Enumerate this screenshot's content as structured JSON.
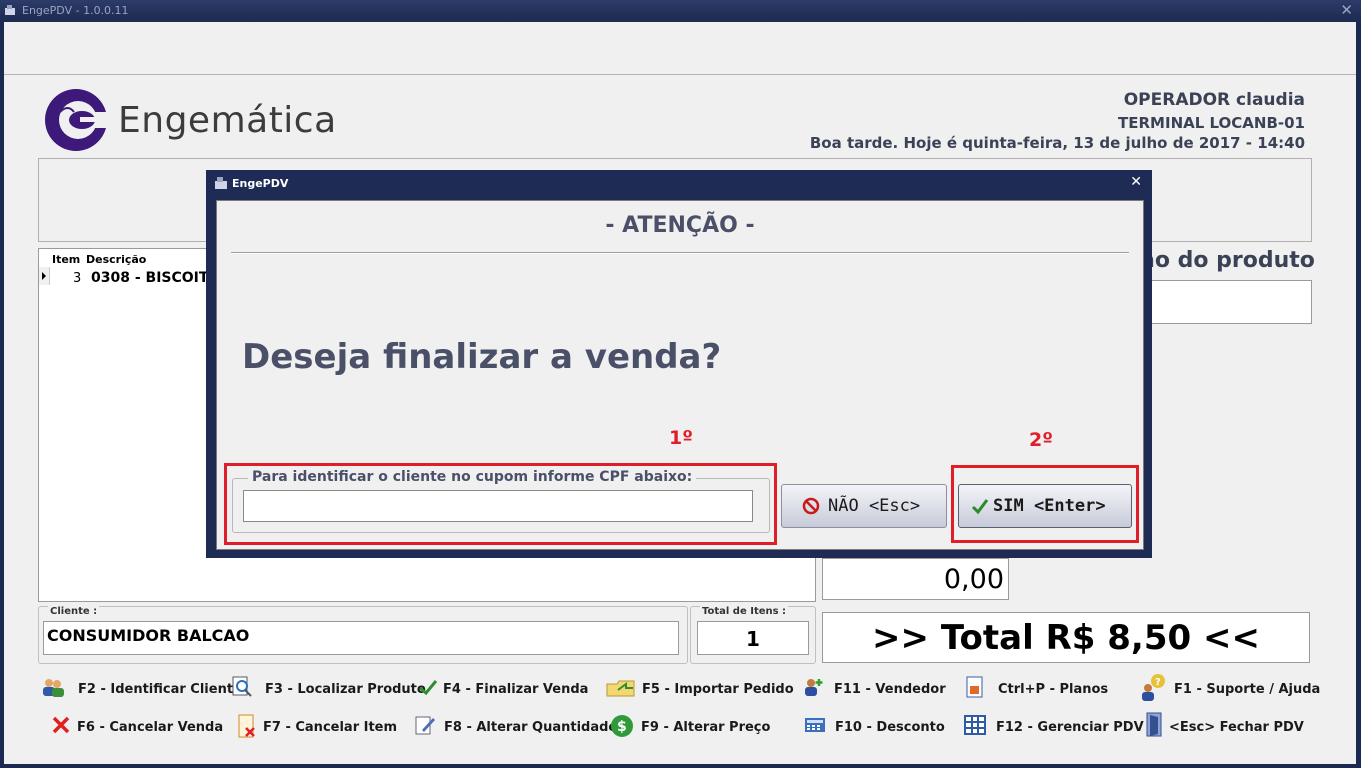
{
  "window": {
    "title": "EngePDV - 1.0.0.11",
    "close_glyph": "✕"
  },
  "logo": {
    "text": "Engemática",
    "icon": "engematica-logo"
  },
  "operator": {
    "line1": "OPERADOR claudia",
    "line2": "TERMINAL LOCANB-01",
    "line3": "Boa tarde. Hoje é quinta-feira, 13 de julho de 2017 - 14:40"
  },
  "grid": {
    "headers": [
      "Item",
      "Descrição"
    ],
    "rows": [
      {
        "item": "3",
        "descricao": "0308 - BISCOIT"
      }
    ]
  },
  "product_label": "ão do produto",
  "subtotal_value": "0,00",
  "client": {
    "label": "Cliente :",
    "value": "CONSUMIDOR BALCAO"
  },
  "total_items": {
    "label": "Total de Itens :",
    "value": "1"
  },
  "total": "&gt;&gt; Total R$ 8,50 &lt;&lt;",
  "total_text": ">> Total R$ 8,50 <<",
  "shortcuts_row1": [
    {
      "label": "F2 - Identificar Cliente",
      "icon": "users-icon"
    },
    {
      "label": "F3 - Localizar Produto",
      "icon": "search-doc-icon"
    },
    {
      "label": "F4 - Finalizar Venda",
      "icon": "check-icon"
    },
    {
      "label": "F5 - Importar Pedido",
      "icon": "folder-import-icon"
    },
    {
      "label": "F11 - Vendedor",
      "icon": "add-user-icon"
    },
    {
      "label": "Ctrl+P - Planos",
      "icon": "document-icon"
    },
    {
      "label": "F1 - Suporte / Ajuda",
      "icon": "help-icon"
    }
  ],
  "shortcuts_row2": [
    {
      "label": "F6 - Cancelar Venda",
      "icon": "x-icon"
    },
    {
      "label": "F7 - Cancelar Item",
      "icon": "cancel-item-icon"
    },
    {
      "label": "F8 -  Alterar Quantidade",
      "icon": "edit-icon"
    },
    {
      "label": "F9 - Alterar Preço",
      "icon": "dollar-icon"
    },
    {
      "label": "F10 - Desconto",
      "icon": "calculator-icon"
    },
    {
      "label": "F12 - Gerenciar PDV",
      "icon": "grid-icon"
    },
    {
      "label": "<Esc> Fechar PDV",
      "icon": "door-exit-icon"
    }
  ],
  "dialog": {
    "title": "EngePDV",
    "close_glyph": "✕",
    "heading": "- ATENÇÃO -",
    "question": "Deseja finalizar a venda?",
    "step1": "1º",
    "step2": "2º",
    "cpf_label": "Para identificar o cliente no cupom informe CPF abaixo:",
    "cpf_value": "",
    "no_button": "NÃO <Esc>",
    "yes_button": "SIM <Enter>"
  },
  "colors": {
    "accent_red": "#e01e2a",
    "title_bar": "#1e2b55",
    "logo_purple": "#3d1a7a",
    "question_text": "#4a5068"
  }
}
